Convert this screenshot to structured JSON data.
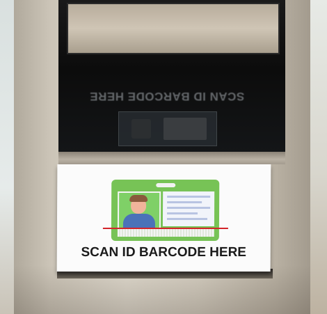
{
  "scene": {
    "sticker_text": "SCAN ID BARCODE HERE",
    "reflected_text": "SCAN ID BARCODE HERE",
    "id_card": {
      "icon": "id-card-icon",
      "card_color": "#77c356",
      "scan_line_color": "#d3242a"
    },
    "colors": {
      "steel": "#cbc4b7",
      "glass": "#0c0c0c",
      "sticker": "#fbfbfb"
    }
  }
}
